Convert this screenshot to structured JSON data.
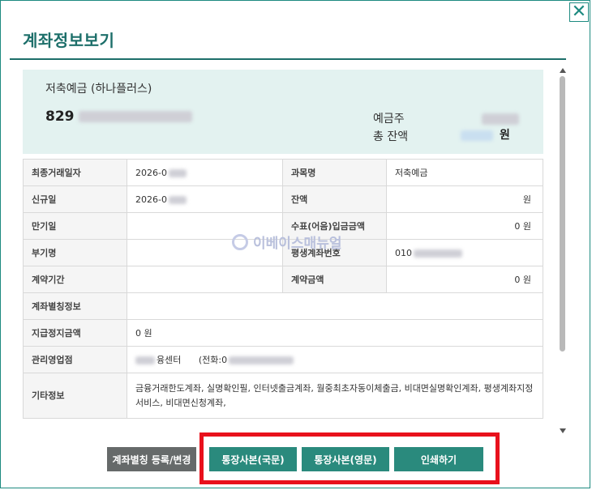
{
  "dialog": {
    "title": "계좌정보보기",
    "close_symbol": "✕"
  },
  "summary": {
    "account_name": "저축예금 (하나플러스)",
    "account_number_visible": "829",
    "holder_label": "예금주",
    "balance_label": "총 잔액",
    "balance_unit": "원"
  },
  "table": {
    "rows": [
      {
        "l1": "최종거래일자",
        "v1": "2026-0",
        "l2": "과목명",
        "v2": "저축예금"
      },
      {
        "l1": "신규일",
        "v1": "2026-0",
        "l2": "잔액",
        "v2": "원"
      },
      {
        "l1": "만기일",
        "v1": "",
        "l2": "수표(어음)입금금액",
        "v2": "0 원"
      },
      {
        "l1": "부기명",
        "v1": "",
        "l2": "평생계좌번호",
        "v2": "010"
      },
      {
        "l1": "계약기간",
        "v1": "",
        "l2": "계약금액",
        "v2": "0 원"
      }
    ],
    "alias_label": "계좌별칭정보",
    "alias_value": "",
    "stop_label": "지급정지금액",
    "stop_value": "0 원",
    "branch_label": "관리영업점",
    "branch_value": "융센터",
    "branch_phone": "(전화:0",
    "etc_label": "기타정보",
    "etc_value": "금융거래한도계좌, 실명확인필, 인터넷출금계좌, 월중최초자동이체출금, 비대면실명확인계좌, 평생계좌지정서비스, 비대면신청계좌,"
  },
  "watermark": "이베이스매뉴얼",
  "buttons": {
    "alias": "계좌별칭 등록/변경",
    "passbook_kr": "통장사본(국문)",
    "passbook_en": "통장사본(영문)",
    "print": "인쇄하기"
  },
  "colors": {
    "accent": "#1d6f6a",
    "button_green": "#2a8a7d",
    "button_gray": "#666a6a",
    "highlight": "#e8111c",
    "summary_bg": "#e3f2f0"
  }
}
